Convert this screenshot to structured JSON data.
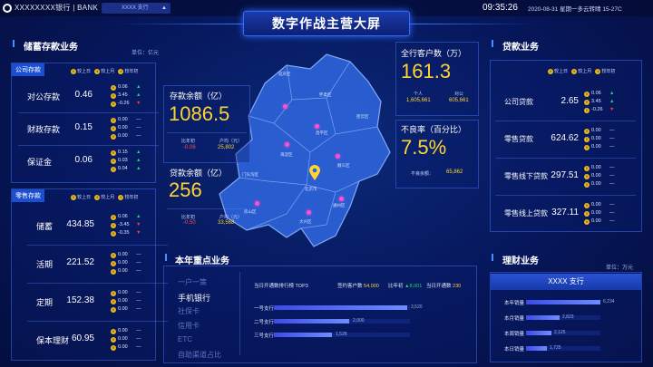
{
  "header": {
    "bank_name": "XXXXXXXX银行 | BANK",
    "branch": "XXXX 支行",
    "title": "数字作战主营大屏",
    "time": "09:35:26",
    "date_weather": "2020-08-31  星期一多云转晴  15-27C"
  },
  "legend": {
    "last_day": "较上日",
    "last_month": "较上月",
    "year_start": "较年初"
  },
  "deposits": {
    "title": "储蓄存款业务",
    "unit": "单位：亿元",
    "corporate_tab": "公司存款",
    "corporate_rows": [
      {
        "label": "对公存款",
        "value": "0.46",
        "changes": [
          "0.06",
          "3.45",
          "-0.26"
        ]
      },
      {
        "label": "财政存款",
        "value": "0.15",
        "changes": [
          "0.00",
          "0.00",
          "0.00"
        ]
      },
      {
        "label": "保证金",
        "value": "0.06",
        "changes": [
          "0.15",
          "0.03",
          "0.04"
        ]
      }
    ],
    "retail_tab": "零售存款",
    "retail_rows": [
      {
        "label": "储蓄",
        "value": "434.85",
        "changes": [
          "0.06",
          "-3.45",
          "-0.35"
        ]
      },
      {
        "label": "活期",
        "value": "221.52",
        "changes": [
          "0.00",
          "0.00",
          "0.00"
        ]
      },
      {
        "label": "定期",
        "value": "152.38",
        "changes": [
          "0.00",
          "0.00",
          "0.00"
        ]
      },
      {
        "label": "保本理财",
        "value": "60.95",
        "changes": [
          "0.00",
          "0.00",
          "0.00"
        ]
      }
    ]
  },
  "kpis": {
    "deposit_balance": {
      "label": "存款余额（亿）",
      "value": "1086.5",
      "sub1_label": "比年初",
      "sub1_value": "-0.06",
      "sub2_label": "户均（元）",
      "sub2_value": "25,802"
    },
    "loan_balance": {
      "label": "贷款余额（亿）",
      "value": "256",
      "sub1_label": "比年初",
      "sub1_value": "-0.50",
      "sub2_label": "户均（元）",
      "sub2_value": "33,568"
    },
    "customers": {
      "label": "全行客户数（万）",
      "value": "161.3",
      "sub1_label": "个人",
      "sub1_value": "1,605,661",
      "sub2_label": "对公",
      "sub2_value": "605,661"
    },
    "npl": {
      "label": "不良率（百分比）",
      "value": "7.5%",
      "sub_label": "不良余额：",
      "sub_value": "65,862"
    }
  },
  "map": {
    "labels": [
      "延庆区",
      "怀柔区",
      "密云区",
      "昌平区",
      "顺义区",
      "平谷区",
      "海淀区",
      "朝阳区",
      "门头沟区",
      "北京市",
      "通州区",
      "房山区",
      "大兴区"
    ]
  },
  "key_business": {
    "title": "本年重点业务",
    "menu": [
      "一户一策",
      "手机银行",
      "社保卡",
      "信用卡",
      "ETC",
      "自助渠道占比"
    ],
    "active_index": 1,
    "ranking_title": "当日开通数排行榜 TOP3",
    "signed_label": "签约客户数",
    "signed_value": "54,000",
    "ytd_label": "比年初",
    "ytd_value": "8,001",
    "today_label": "当日开通数",
    "today_value": "230",
    "bars": [
      {
        "label": "一号支行",
        "value": 3520
      },
      {
        "label": "二号支行",
        "value": 2000
      },
      {
        "label": "三号支行",
        "value": 1528
      }
    ],
    "bar_max": 3600
  },
  "loans": {
    "title": "贷款业务",
    "rows": [
      {
        "label": "公司贷款",
        "value": "2.65",
        "changes": [
          "0.06",
          "3.45",
          "-0.26"
        ]
      },
      {
        "label": "零售贷款",
        "value": "624.62",
        "changes": [
          "0.00",
          "0.00",
          "0.00"
        ]
      },
      {
        "label": "零售线下贷款",
        "value": "297.51",
        "changes": [
          "0.00",
          "0.00",
          "0.00"
        ]
      },
      {
        "label": "零售线上贷款",
        "value": "327.11",
        "changes": [
          "0.00",
          "0.00",
          "0.00"
        ]
      }
    ]
  },
  "wealth": {
    "title": "理财业务",
    "unit": "单位：万元",
    "branch_label": "XXXX 支行",
    "bars": [
      {
        "label": "本年销量",
        "value": 6234
      },
      {
        "label": "本月销量",
        "value": 2823
      },
      {
        "label": "本周销量",
        "value": 2125
      },
      {
        "label": "本日销量",
        "value": 1725
      }
    ],
    "bar_max": 6234
  },
  "colors": {
    "accent": "#2f6bff",
    "yellow": "#ffd430",
    "up": "#24d36b",
    "down": "#ff3b3b"
  }
}
